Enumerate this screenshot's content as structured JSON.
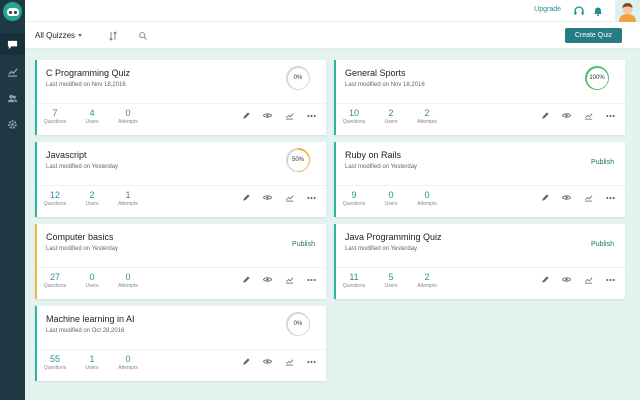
{
  "topbar": {
    "upgrade": "Upgrade"
  },
  "toolbar": {
    "filter": "All Quizzes",
    "create": "Create Quiz"
  },
  "stat_labels": {
    "questions": "Questions",
    "users": "Users",
    "attempts": "Attempts"
  },
  "quizzes": [
    {
      "title": "C Programming Quiz",
      "modified": "Last modified on Nov 18,2016",
      "questions": "7",
      "users": "4",
      "attempts": "0",
      "progress": "0%"
    },
    {
      "title": "General Sports",
      "modified": "Last modified on Nov 18,2016",
      "questions": "10",
      "users": "2",
      "attempts": "2",
      "progress": "100%"
    },
    {
      "title": "Javascript",
      "modified": "Last modified on Yesterday",
      "questions": "12",
      "users": "2",
      "attempts": "1",
      "progress": "50%"
    },
    {
      "title": "Ruby on Rails",
      "modified": "Last modified on Yesterday",
      "questions": "9",
      "users": "0",
      "attempts": "0",
      "publish": "Publish"
    },
    {
      "title": "Computer basics",
      "modified": "Last modified on Yesterday",
      "questions": "27",
      "users": "0",
      "attempts": "0",
      "publish": "Publish"
    },
    {
      "title": "Java Programming Quiz",
      "modified": "Last modified on Yesterday",
      "questions": "11",
      "users": "5",
      "attempts": "2",
      "publish": "Publish"
    },
    {
      "title": "Machine learning in AI",
      "modified": "Last modified on Oct 28,2016",
      "questions": "55",
      "users": "1",
      "attempts": "0",
      "progress": "0%"
    }
  ],
  "colors": {
    "accent": "#267c82",
    "published_border": "#2eb59c",
    "draft_border": "#f3b54a",
    "sidebar": "#1f3944",
    "progress_full": "#4cc36b",
    "progress_half": "#f3a832",
    "progress_empty": "#d6d6d6"
  }
}
